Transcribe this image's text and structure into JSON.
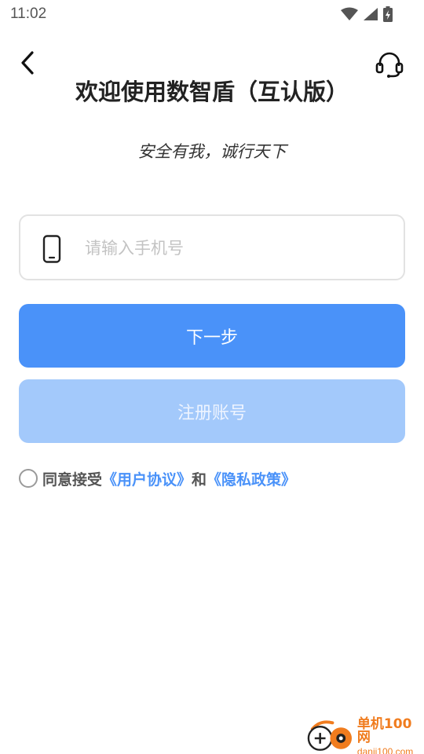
{
  "status_bar": {
    "time": "11:02",
    "icons": [
      "wifi-icon",
      "signal-icon",
      "battery-charging-icon"
    ]
  },
  "header": {
    "back_icon": "chevron-left-icon",
    "support_icon": "headset-icon",
    "title": "欢迎使用数智盾（互认版）",
    "slogan": "安全有我，诚行天下"
  },
  "form": {
    "phone_icon": "mobile-phone-icon",
    "phone_placeholder": "请输入手机号",
    "phone_value": ""
  },
  "buttons": {
    "next_label": "下一步",
    "register_label": "注册账号"
  },
  "agreement": {
    "checked": false,
    "prefix": "同意接受",
    "user_agreement": "《用户协议》",
    "and": "和",
    "privacy_policy": "《隐私政策》"
  },
  "colors": {
    "primary": "#4a92f9",
    "primary_disabled": "#a3c9fb",
    "watermark": "#f07c1e"
  },
  "watermark": {
    "name": "单机100网",
    "url": "danji100.com"
  }
}
